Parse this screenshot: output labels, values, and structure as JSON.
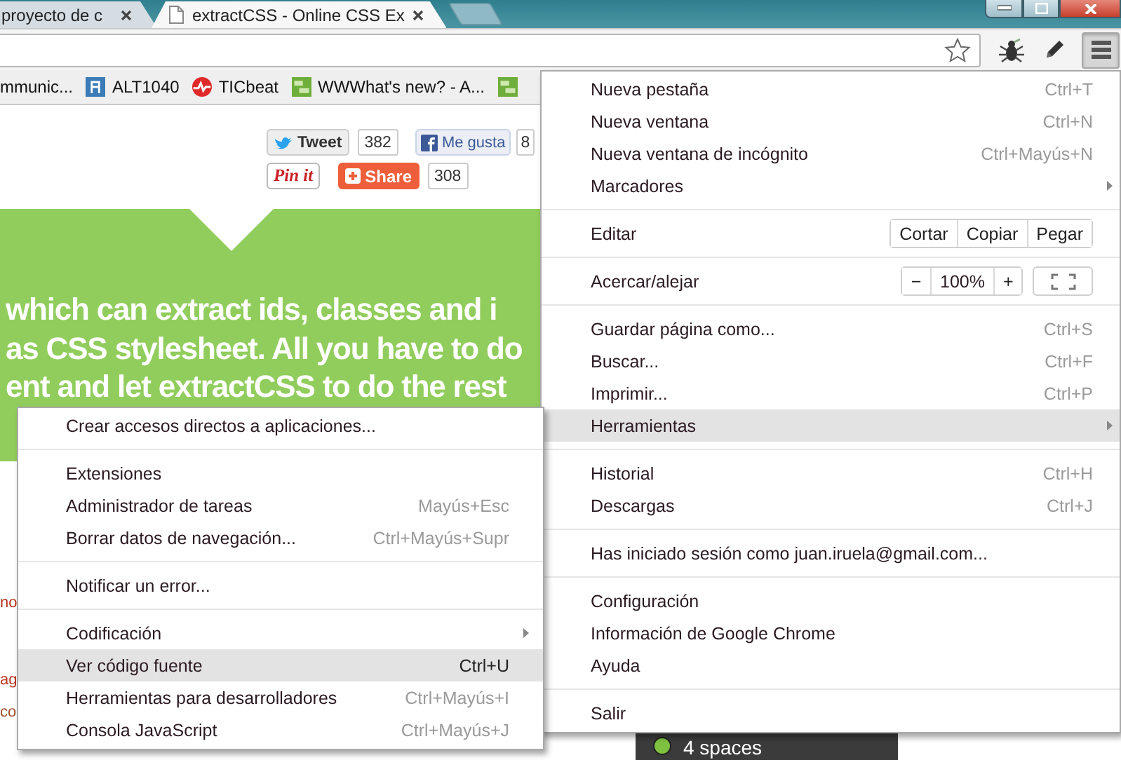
{
  "tabs": [
    {
      "kind": "plain",
      "title": "proyecto de c",
      "selected": false
    },
    {
      "kind": "with-page-icon",
      "title": "extractCSS - Online CSS Ex",
      "selected": true
    }
  ],
  "menu_button": {
    "pressed": true
  },
  "bookmarks": [
    {
      "kind": "text",
      "label": "mmunic..."
    },
    {
      "kind": "blue-square",
      "label": "ALT1040"
    },
    {
      "kind": "red-circle",
      "label": "TICbeat"
    },
    {
      "kind": "green-square",
      "label": "WWWhat's new? - A..."
    },
    {
      "kind": "green-square"
    }
  ],
  "social": [
    {
      "kind": "tweet",
      "label": "Tweet",
      "count": "382"
    },
    {
      "kind": "like",
      "label": "Me gusta",
      "count": "8"
    },
    {
      "kind": "pinit",
      "label": "Pin it"
    },
    {
      "kind": "share",
      "label": "Share",
      "count": "308"
    }
  ],
  "banner": {
    "lines": [
      "which can extract ids, classes and i",
      "as CSS stylesheet. All you have to do",
      "ent and let extractCSS to do the rest"
    ]
  },
  "side_fragments": [
    "no",
    "ag",
    "co"
  ],
  "status_chip": {
    "label": "4 spaces"
  },
  "menu": {
    "items": [
      {
        "kind": "item",
        "label": "Nueva pestaña",
        "shortcut": "Ctrl+T",
        "submenu": false,
        "selected": false
      },
      {
        "kind": "item",
        "label": "Nueva ventana",
        "shortcut": "Ctrl+N",
        "submenu": false,
        "selected": false
      },
      {
        "kind": "item",
        "label": "Nueva ventana de incógnito",
        "shortcut": "Ctrl+Mayús+N",
        "submenu": false,
        "selected": false
      },
      {
        "kind": "item",
        "label": "Marcadores",
        "submenu": true,
        "selected": false
      },
      {
        "kind": "separator"
      },
      {
        "kind": "edit",
        "label": "Editar",
        "buttons": [
          "Cortar",
          "Copiar",
          "Pegar"
        ]
      },
      {
        "kind": "separator"
      },
      {
        "kind": "zoom",
        "label": "Acercar/alejar",
        "minus": "−",
        "value": "100%",
        "plus": "+"
      },
      {
        "kind": "separator"
      },
      {
        "kind": "item",
        "label": "Guardar página como...",
        "shortcut": "Ctrl+S",
        "submenu": false,
        "selected": false
      },
      {
        "kind": "item",
        "label": "Buscar...",
        "shortcut": "Ctrl+F",
        "submenu": false,
        "selected": false
      },
      {
        "kind": "item",
        "label": "Imprimir...",
        "shortcut": "Ctrl+P",
        "submenu": false,
        "selected": false
      },
      {
        "kind": "item",
        "label": "Herramientas",
        "submenu": true,
        "selected": true
      },
      {
        "kind": "separator"
      },
      {
        "kind": "item",
        "label": "Historial",
        "shortcut": "Ctrl+H",
        "submenu": false,
        "selected": false
      },
      {
        "kind": "item",
        "label": "Descargas",
        "shortcut": "Ctrl+J",
        "submenu": false,
        "selected": false
      },
      {
        "kind": "separator"
      },
      {
        "kind": "item",
        "label": "Has iniciado sesión como juan.iruela@gmail.com...",
        "submenu": false,
        "selected": false
      },
      {
        "kind": "separator"
      },
      {
        "kind": "item",
        "label": "Configuración",
        "submenu": false,
        "selected": false
      },
      {
        "kind": "item",
        "label": "Información de Google Chrome",
        "submenu": false,
        "selected": false
      },
      {
        "kind": "item",
        "label": "Ayuda",
        "submenu": false,
        "selected": false
      },
      {
        "kind": "separator"
      },
      {
        "kind": "item",
        "label": "Salir",
        "submenu": false,
        "selected": false
      }
    ]
  },
  "submenu": {
    "items": [
      {
        "kind": "item",
        "label": "Crear accesos directos a aplicaciones...",
        "submenu": false,
        "selected": false
      },
      {
        "kind": "separator"
      },
      {
        "kind": "item",
        "label": "Extensiones",
        "submenu": false,
        "selected": false
      },
      {
        "kind": "item",
        "label": "Administrador de tareas",
        "shortcut": "Mayús+Esc",
        "submenu": false,
        "selected": false
      },
      {
        "kind": "item",
        "label": "Borrar datos de navegación...",
        "shortcut": "Ctrl+Mayús+Supr",
        "submenu": false,
        "selected": false
      },
      {
        "kind": "separator"
      },
      {
        "kind": "item",
        "label": "Notificar un error...",
        "submenu": false,
        "selected": false
      },
      {
        "kind": "separator"
      },
      {
        "kind": "item",
        "label": "Codificación",
        "submenu": true,
        "selected": false
      },
      {
        "kind": "item",
        "label": "Ver código fuente",
        "shortcut": "Ctrl+U",
        "submenu": false,
        "selected": true
      },
      {
        "kind": "item",
        "label": "Herramientas para desarrolladores",
        "shortcut": "Ctrl+Mayús+I",
        "submenu": false,
        "selected": false
      },
      {
        "kind": "item",
        "label": "Consola JavaScript",
        "shortcut": "Ctrl+Mayús+J",
        "submenu": false,
        "selected": false
      }
    ]
  }
}
